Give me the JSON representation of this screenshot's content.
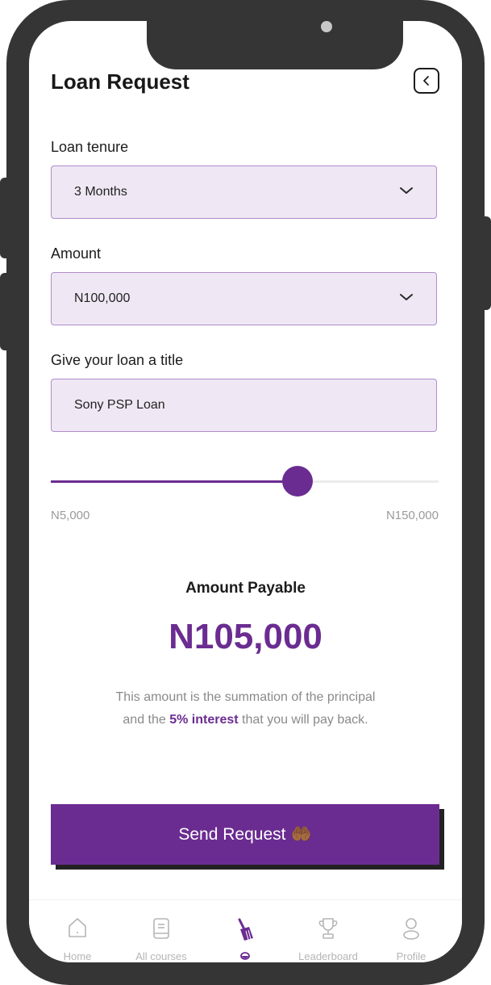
{
  "header": {
    "title": "Loan Request"
  },
  "form": {
    "tenure_label": "Loan tenure",
    "tenure_value": "3 Months",
    "amount_label": "Amount",
    "amount_value": "N100,000",
    "title_label": "Give your loan a title",
    "title_value": "Sony PSP Loan"
  },
  "slider": {
    "min_label": "N5,000",
    "max_label": "N150,000",
    "position_fraction": 0.637
  },
  "summary": {
    "label": "Amount Payable",
    "value": "N105,000",
    "note_line1": "This amount is the summation of the principal",
    "note_pre": "and the ",
    "note_highlight": "5% interest",
    "note_post": " that you will pay back."
  },
  "cta": {
    "label": "Send Request",
    "emoji": "🤲🏾"
  },
  "tabbar": {
    "items": [
      {
        "label": "Home",
        "icon": "home-icon"
      },
      {
        "label": "All courses",
        "icon": "book-icon"
      },
      {
        "label": "",
        "icon": "broom-icon",
        "active": true
      },
      {
        "label": "Leaderboard",
        "icon": "trophy-icon"
      },
      {
        "label": "Profile",
        "icon": "user-icon"
      }
    ]
  },
  "colors": {
    "accent": "#6b2c91",
    "field_bg": "#efe8f4",
    "field_border": "#b08ccb",
    "frame": "#353535"
  }
}
